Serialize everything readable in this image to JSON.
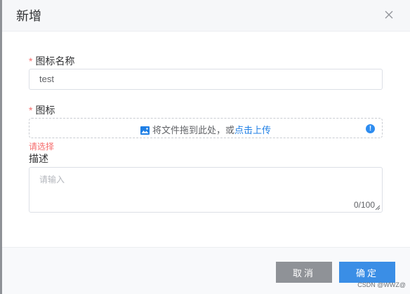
{
  "dialog": {
    "title": "新增",
    "close_icon": "close-icon"
  },
  "form": {
    "name": {
      "required_mark": "*",
      "label": "图标名称",
      "value": "test"
    },
    "icon": {
      "required_mark": "*",
      "label": "图标",
      "upload_text": "将文件拖到此处，或",
      "upload_link": "点击上传",
      "upload_icon": "image-icon",
      "info_icon": "info-icon",
      "error": "请选择"
    },
    "description": {
      "label": "描述",
      "placeholder": "请输入",
      "counter": "0/100"
    }
  },
  "footer": {
    "cancel_label": "取消",
    "confirm_label": "确定"
  },
  "watermark": "CSDN @WWZ@"
}
